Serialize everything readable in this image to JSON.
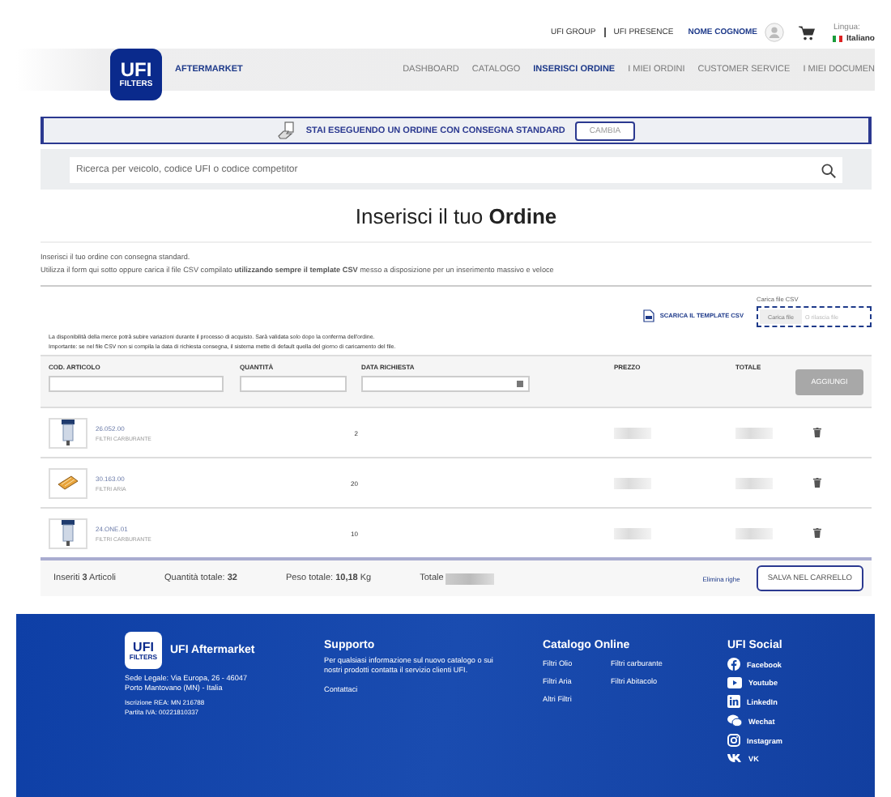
{
  "top_bar": {
    "links": [
      "UFI GROUP",
      "UFI PRESENCE"
    ],
    "user_name": "NOME COGNOME",
    "language_label": "Lingua:",
    "language": "Italiano"
  },
  "nav": {
    "logo_top": "UFI",
    "logo_bottom": "FILTERS",
    "brand": "AFTERMARKET",
    "items": [
      {
        "label": "DASHBOARD",
        "selected": false
      },
      {
        "label": "CATALOGO",
        "selected": false
      },
      {
        "label": "INSERISCI ORDINE",
        "selected": true
      },
      {
        "label": "I MIEI ORDINI",
        "selected": false
      },
      {
        "label": "CUSTOMER SERVICE",
        "selected": false
      },
      {
        "label": "I MIEI DOCUMEN",
        "selected": false
      }
    ]
  },
  "banner": {
    "text": "STAI ESEGUENDO UN ORDINE CON CONSEGNA STANDARD",
    "button": "CAMBIA"
  },
  "search": {
    "placeholder": "Ricerca per veicolo, codice UFI o codice competitor"
  },
  "title": "Inserisci il tuo **Ordine**",
  "intro": [
    "Inserisci il tuo ordine con consegna standard.",
    "Utilizza il form qui sotto oppure carica il file CSV compilato **utilizzando sempre il template CSV** messo a disposizione per un inserimento massivo e veloce"
  ],
  "csv": {
    "download": "SCARICA IL TEMPLATE CSV",
    "upload_label": "Carica file CSV",
    "upload_button": "Carica file",
    "drop_text": "O rilascia file"
  },
  "notes": [
    "La disponibilità della merce potrà subire variazioni durante il processo di acquisto. Sarà validata solo dopo la conferma dell'ordine.",
    "Importante: se nel file CSV non si compila la data di richiesta consegna, il sistema mette di default quella del giorno di caricamento del file."
  ],
  "table": {
    "columns": [
      "COD. ARTICOLO",
      "QUANTITÀ",
      "DATA RICHIESTA",
      "PREZZO",
      "TOTALE"
    ],
    "add_button": {
      "label": "AGGIUNGI",
      "disabled": true
    },
    "rows": [
      {
        "code": "26.052.00",
        "category": "FILTRI CARBURANTE",
        "quantity": "2",
        "kind": "cartridge"
      },
      {
        "code": "30.163.00",
        "category": "FILTRI ARIA",
        "quantity": "20",
        "kind": "panel"
      },
      {
        "code": "24.ONE.01",
        "category": "FILTRI CARBURANTE",
        "quantity": "10",
        "kind": "cartridge"
      }
    ]
  },
  "summary": {
    "articles": "Inseriti **3** Articoli",
    "quantity": "Quantità totale: **32**",
    "weight": "Peso totale: **10,18** Kg",
    "total_label": "Totale",
    "delete_link": "Elimina righe",
    "save_button": "SALVA NEL CARRELLO"
  },
  "footer": {
    "logo_top": "UFI",
    "logo_bottom": "FILTERS",
    "brand": "UFI Aftermarket",
    "address": [
      "Sede Legale: Via Europa, 26 - 46047",
      "Porto Mantovano (MN) - Italia"
    ],
    "registry": [
      "Iscrizione REA: MN 216788",
      "Partita IVA: 00221810337"
    ],
    "support": {
      "title": "Supporto",
      "text": "Per qualsiasi informazione sul nuovo catalogo o sui nostri prodotti contatta il servizio clienti UFI.",
      "link": "Contattaci"
    },
    "catalog": {
      "title": "Catalogo Online",
      "links": [
        "Filtri Olio",
        "Filtri carburante",
        "Filtri Aria",
        "Filtri Abitacolo",
        "Altri Filtri"
      ]
    },
    "social": {
      "title": "UFI Social",
      "items": [
        {
          "label": "Facebook",
          "kind": "facebook"
        },
        {
          "label": "Youtube",
          "kind": "youtube"
        },
        {
          "label": "LinkedIn",
          "kind": "linkedin"
        },
        {
          "label": "Wechat",
          "kind": "wechat"
        },
        {
          "label": "Instagram",
          "kind": "instagram"
        },
        {
          "label": "VK",
          "kind": "vk"
        }
      ]
    }
  }
}
